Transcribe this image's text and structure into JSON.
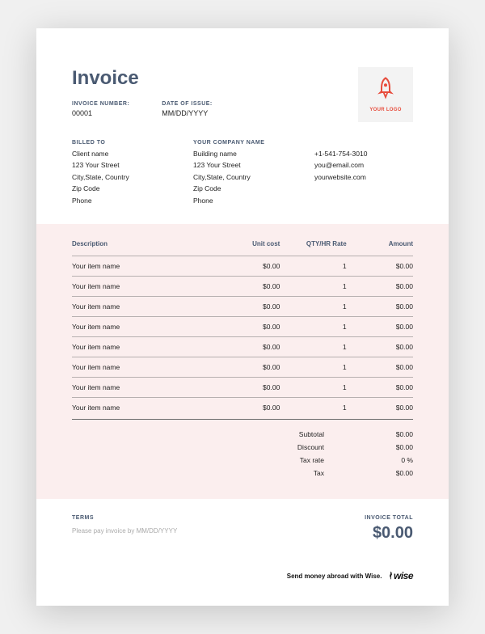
{
  "title": "Invoice",
  "meta": {
    "invoice_number_label": "INVOICE NUMBER:",
    "invoice_number": "00001",
    "date_label": "DATE OF ISSUE:",
    "date": "MM/DD/YYYY"
  },
  "logo_text": "YOUR LOGO",
  "billed_to": {
    "label": "BILLED TO",
    "lines": [
      "Client name",
      "123 Your Street",
      "City,State, Country",
      "Zip Code",
      "Phone"
    ]
  },
  "company": {
    "label": "YOUR COMPANY NAME",
    "lines": [
      "Building name",
      "123 Your Street",
      "City,State, Country",
      "Zip Code",
      "Phone"
    ]
  },
  "contact": {
    "lines": [
      "+1-541-754-3010",
      "you@email.com",
      "yourwebsite.com"
    ]
  },
  "table": {
    "headers": {
      "desc": "Description",
      "unit": "Unit cost",
      "qty": "QTY/HR Rate",
      "amt": "Amount"
    },
    "rows": [
      {
        "desc": "Your item name",
        "unit": "$0.00",
        "qty": "1",
        "amt": "$0.00"
      },
      {
        "desc": "Your item name",
        "unit": "$0.00",
        "qty": "1",
        "amt": "$0.00"
      },
      {
        "desc": "Your item name",
        "unit": "$0.00",
        "qty": "1",
        "amt": "$0.00"
      },
      {
        "desc": "Your item name",
        "unit": "$0.00",
        "qty": "1",
        "amt": "$0.00"
      },
      {
        "desc": "Your item name",
        "unit": "$0.00",
        "qty": "1",
        "amt": "$0.00"
      },
      {
        "desc": "Your item name",
        "unit": "$0.00",
        "qty": "1",
        "amt": "$0.00"
      },
      {
        "desc": "Your item name",
        "unit": "$0.00",
        "qty": "1",
        "amt": "$0.00"
      },
      {
        "desc": "Your item name",
        "unit": "$0.00",
        "qty": "1",
        "amt": "$0.00"
      }
    ]
  },
  "totals": [
    {
      "label": "Subtotal",
      "val": "$0.00"
    },
    {
      "label": "Discount",
      "val": "$0.00"
    },
    {
      "label": "Tax rate",
      "val": "0 %"
    },
    {
      "label": "Tax",
      "val": "$0.00"
    }
  ],
  "terms": {
    "label": "TERMS",
    "text": "Please pay invoice by MM/DD/YYYY"
  },
  "invoice_total": {
    "label": "INVOICE TOTAL",
    "value": "$0.00"
  },
  "brand": {
    "tagline": "Send money abroad with Wise.",
    "name": "wise"
  }
}
